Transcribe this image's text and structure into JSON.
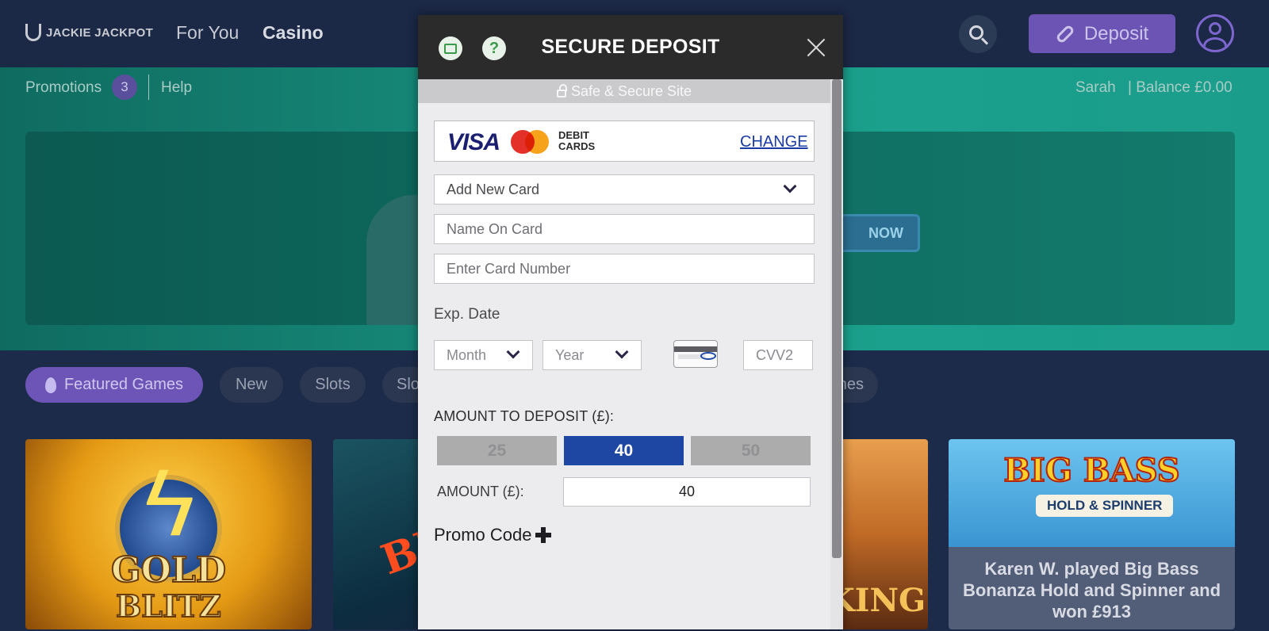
{
  "brand": {
    "logo_text": "JACKIE JACKPOT"
  },
  "topnav": {
    "links": [
      "For You",
      "Casino"
    ],
    "deposit_label": "Deposit",
    "icons": [
      "search-icon",
      "deposit-icon",
      "profile-icon"
    ]
  },
  "subnav": {
    "promotions_label": "Promotions",
    "promotions_count": "3",
    "help_label": "Help",
    "user_name": "Sarah",
    "balance": "| Balance £0.00"
  },
  "categories": [
    "Featured Games",
    "New",
    "Slots",
    "Slo",
    "nes"
  ],
  "games": {
    "tile1": {
      "line1": "GOLD",
      "line2": "BLITZ"
    },
    "tile2": {
      "title": "BIG"
    },
    "tile3": {
      "title": "KING"
    },
    "tile4": {
      "title": "BIG BASS",
      "subtitle": "HOLD & SPINNER",
      "caption": "Karen W. played Big Bass Bonanza Hold and Spinner and won £913"
    }
  },
  "hero": {
    "button_text": "NOW"
  },
  "modal": {
    "title": "SECURE DEPOSIT",
    "safe_site": "Safe & Secure Site",
    "help_glyph": "?",
    "card_brands": {
      "visa": "VISA",
      "debit_line1": "DEBIT",
      "debit_line2": "CARDS"
    },
    "change_label": "CHANGE",
    "card_select": "Add New Card",
    "name_placeholder": "Name On Card",
    "number_placeholder": "Enter Card Number",
    "exp_label": "Exp. Date",
    "month_label": "Month",
    "year_label": "Year",
    "cvv_placeholder": "CVV2",
    "amount_label": "AMOUNT TO DEPOSIT (£):",
    "amount_options": [
      "25",
      "40",
      "50"
    ],
    "selected_amount": "40",
    "amount_field_label": "AMOUNT (£):",
    "amount_value": "40",
    "promo_label": "Promo Code"
  },
  "colors": {
    "nav_bg": "#1b2846",
    "accent_purple": "#6b54b3",
    "selected_amount_blue": "#1e46a3",
    "modal_header": "#2b2b2b",
    "link_blue": "#1a3aa5"
  }
}
